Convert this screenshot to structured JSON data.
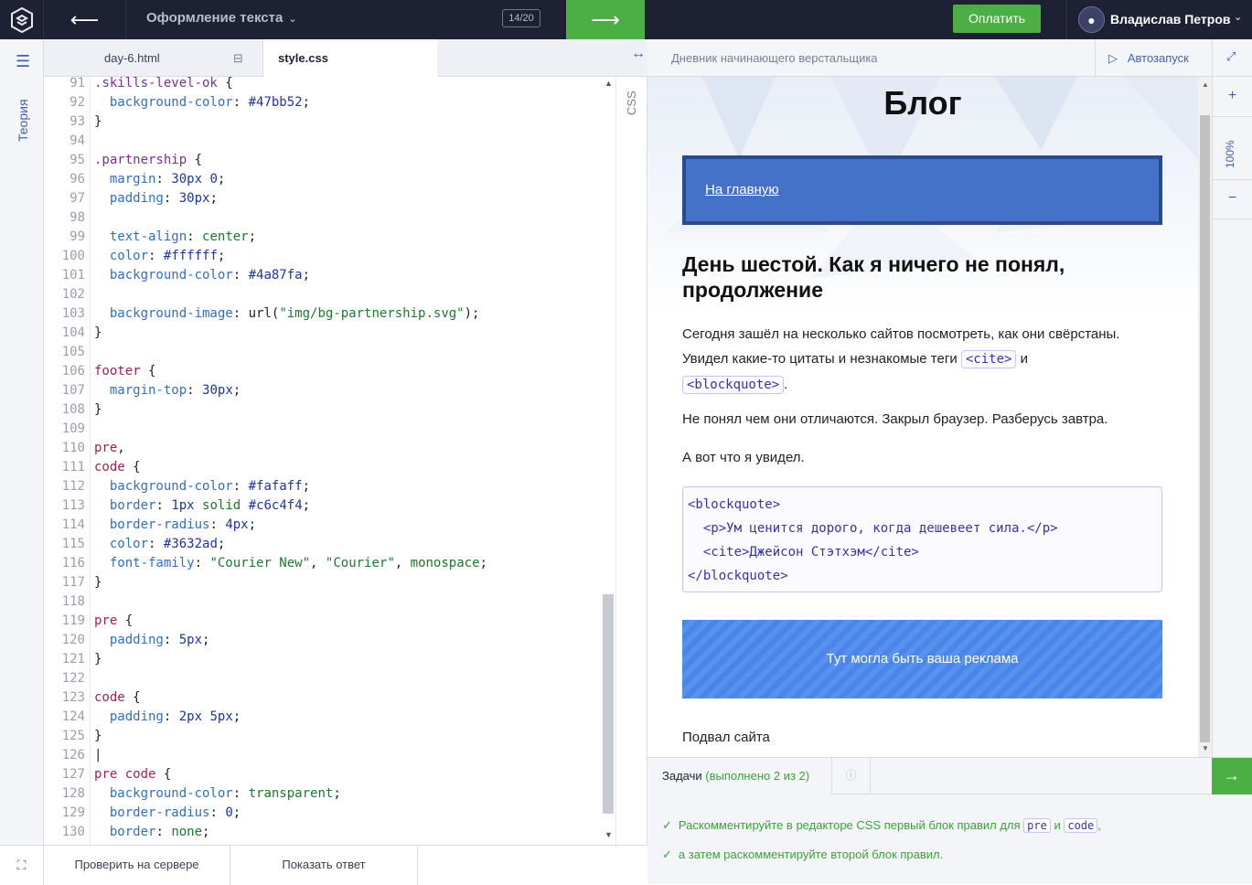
{
  "topbar": {
    "lesson_title": "Оформление текста",
    "counter": "14/20",
    "pay_label": "Оплатить",
    "user_name": "Владислав Петров",
    "back_arrow": "⟵",
    "next_arrow": "⟶"
  },
  "rail": {
    "theory_label": "Теория"
  },
  "editor": {
    "tabs": [
      {
        "label": "day-6.html"
      },
      {
        "label": "style.css"
      }
    ],
    "side_label": "CSS",
    "check_button": "Проверить на сервере",
    "answer_button": "Показать ответ"
  },
  "code_lines": [
    {
      "n": "91",
      "html": "<span class='sel'>.skills-level-ok</span> <span class='pun'>{</span>"
    },
    {
      "n": "92",
      "html": "  <span class='prop'>background-color</span><span class='pun'>:</span> <span class='val'>#47bb52</span><span class='pun'>;</span>"
    },
    {
      "n": "93",
      "html": "<span class='pun'>}</span>"
    },
    {
      "n": "94",
      "html": ""
    },
    {
      "n": "95",
      "html": "<span class='sel'>.partnership</span> <span class='pun'>{</span>"
    },
    {
      "n": "96",
      "html": "  <span class='prop'>margin</span><span class='pun'>:</span> <span class='val'>30px 0</span><span class='pun'>;</span>"
    },
    {
      "n": "97",
      "html": "  <span class='prop'>padding</span><span class='pun'>:</span> <span class='val'>30px</span><span class='pun'>;</span>"
    },
    {
      "n": "98",
      "html": ""
    },
    {
      "n": "99",
      "html": "  <span class='prop'>text-align</span><span class='pun'>:</span> <span class='kw'>center</span><span class='pun'>;</span>"
    },
    {
      "n": "100",
      "html": "  <span class='prop'>color</span><span class='pun'>:</span> <span class='val'>#ffffff</span><span class='pun'>;</span>"
    },
    {
      "n": "101",
      "html": "  <span class='prop'>background-color</span><span class='pun'>:</span> <span class='val'>#4a87fa</span><span class='pun'>;</span>"
    },
    {
      "n": "102",
      "html": ""
    },
    {
      "n": "103",
      "html": "  <span class='prop'>background-image</span><span class='pun'>:</span> <span class='pun'>url(</span><span class='str'>\"img/bg-partnership.svg\"</span><span class='pun'>);</span>"
    },
    {
      "n": "104",
      "html": "<span class='pun'>}</span>"
    },
    {
      "n": "105",
      "html": ""
    },
    {
      "n": "106",
      "html": "<span class='tag'>footer</span> <span class='pun'>{</span>"
    },
    {
      "n": "107",
      "html": "  <span class='prop'>margin-top</span><span class='pun'>:</span> <span class='val'>30px</span><span class='pun'>;</span>"
    },
    {
      "n": "108",
      "html": "<span class='pun'>}</span>"
    },
    {
      "n": "109",
      "html": ""
    },
    {
      "n": "110",
      "html": "<span class='tag'>pre</span><span class='pun'>,</span>"
    },
    {
      "n": "111",
      "html": "<span class='tag'>code</span> <span class='pun'>{</span>"
    },
    {
      "n": "112",
      "html": "  <span class='prop'>background-color</span><span class='pun'>:</span> <span class='val'>#fafaff</span><span class='pun'>;</span>"
    },
    {
      "n": "113",
      "html": "  <span class='prop'>border</span><span class='pun'>:</span> <span class='val'>1px</span> <span class='kw'>solid</span> <span class='val'>#c6c4f4</span><span class='pun'>;</span>"
    },
    {
      "n": "114",
      "html": "  <span class='prop'>border-radius</span><span class='pun'>:</span> <span class='val'>4px</span><span class='pun'>;</span>"
    },
    {
      "n": "115",
      "html": "  <span class='prop'>color</span><span class='pun'>:</span> <span class='val'>#3632ad</span><span class='pun'>;</span>"
    },
    {
      "n": "116",
      "html": "  <span class='prop'>font-family</span><span class='pun'>:</span> <span class='str'>\"Courier New\"</span><span class='pun'>,</span> <span class='str'>\"Courier\"</span><span class='pun'>,</span> <span class='kw'>monospace</span><span class='pun'>;</span>"
    },
    {
      "n": "117",
      "html": "<span class='pun'>}</span>"
    },
    {
      "n": "118",
      "html": ""
    },
    {
      "n": "119",
      "html": "<span class='tag'>pre</span> <span class='pun'>{</span>"
    },
    {
      "n": "120",
      "html": "  <span class='prop'>padding</span><span class='pun'>:</span> <span class='val'>5px</span><span class='pun'>;</span>"
    },
    {
      "n": "121",
      "html": "<span class='pun'>}</span>"
    },
    {
      "n": "122",
      "html": ""
    },
    {
      "n": "123",
      "html": "<span class='tag'>code</span> <span class='pun'>{</span>"
    },
    {
      "n": "124",
      "html": "  <span class='prop'>padding</span><span class='pun'>:</span> <span class='val'>2px 5px</span><span class='pun'>;</span>"
    },
    {
      "n": "125",
      "html": "<span class='pun'>}</span>"
    },
    {
      "n": "126",
      "html": "<span class='pun'>|</span>"
    },
    {
      "n": "127",
      "html": "<span class='tag'>pre</span> <span class='tag'>code</span> <span class='pun'>{</span>"
    },
    {
      "n": "128",
      "html": "  <span class='prop'>background-color</span><span class='pun'>:</span> <span class='kw'>transparent</span><span class='pun'>;</span>"
    },
    {
      "n": "129",
      "html": "  <span class='prop'>border-radius</span><span class='pun'>:</span> <span class='val'>0</span><span class='pun'>;</span>"
    },
    {
      "n": "130",
      "html": "  <span class='prop'>border</span><span class='pun'>:</span> <span class='kw'>none</span><span class='pun'>;</span>"
    }
  ],
  "preview": {
    "title": "Дневник начинающего верстальщика",
    "autorun_label": "Автозапуск",
    "zoom_label": "100%",
    "zoom_plus": "+",
    "zoom_minus": "−",
    "blog_title": "Блог",
    "nav_link": "На главную",
    "heading": "День шестой. Как я ничего не понял, продолжение",
    "para1_a": "Сегодня зашёл на несколько сайтов посмотреть, как они свёрстаны. Увидел какие-то цитаты и незнакомые теги ",
    "para1_code1": "<cite>",
    "para1_b": " и ",
    "para1_code2": "<blockquote>",
    "para1_c": ".",
    "para2": "Не понял чем они отличаются. Закрыл браузер. Разберусь завтра.",
    "para3": "А вот что я увидел.",
    "pre_block": "<blockquote>\n  <p>Ум ценится дорого, когда дешевеет сила.</p>\n  <cite>Джейсон Стэтхэм</cite>\n</blockquote>",
    "ad_text": "Тут могла быть ваша реклама",
    "footer_text": "Подвал сайта"
  },
  "tasks": {
    "tab_label": "Задачи",
    "tab_status": "(выполнено 2 из 2)",
    "item1_a": "Раскомментируйте в редакторе CSS первый блок правил для ",
    "item1_code1": "pre",
    "item1_b": " и ",
    "item1_code2": "code",
    "item1_c": ",",
    "item2": "а затем раскомментируйте второй блок правил."
  }
}
